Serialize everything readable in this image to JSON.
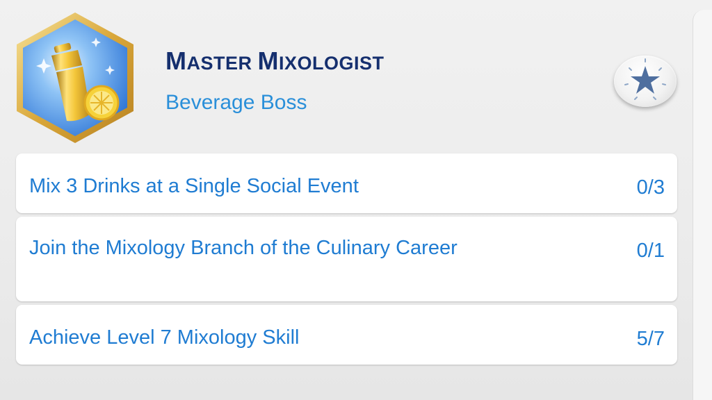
{
  "aspiration": {
    "title_first_cap": "M",
    "title_first_rest": "ASTER ",
    "title_second_cap": "M",
    "title_second_rest": "IXOLOGIST",
    "subtitle": "Beverage Boss",
    "badge_icon": "cocktail-shaker-lemon-icon",
    "badge_color": "#2e75d6",
    "accent_color": "#1f7cd2",
    "title_color": "#152f6e"
  },
  "star_button": {
    "icon": "star-icon"
  },
  "tasks": [
    {
      "label": "Mix 3 Drinks at a Single Social Event",
      "progress": "0/3"
    },
    {
      "label": "Join the Mixology Branch of the Culinary Career",
      "progress": "0/1"
    },
    {
      "label": "Achieve Level 7 Mixology Skill",
      "progress": "5/7"
    }
  ]
}
